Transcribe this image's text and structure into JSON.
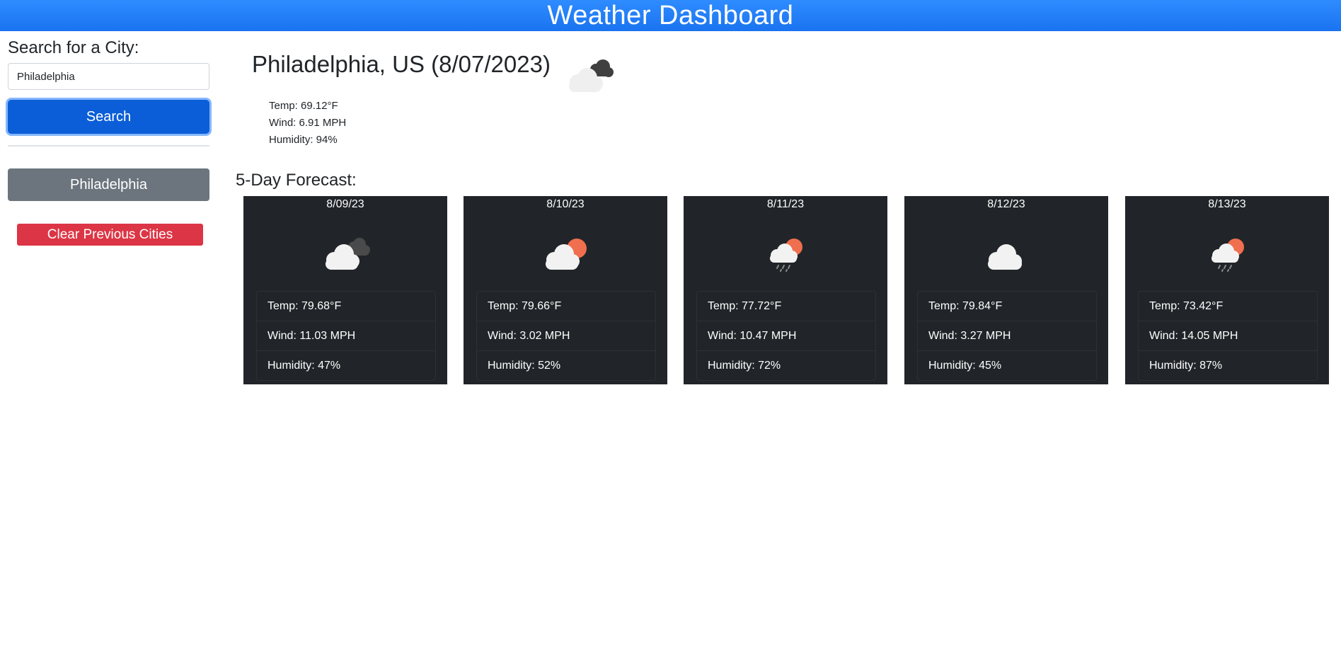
{
  "header": {
    "title": "Weather Dashboard"
  },
  "sidebar": {
    "search_heading": "Search for a City:",
    "search_value": "Philadelphia",
    "search_button": "Search",
    "history": [
      "Philadelphia"
    ],
    "clear_button": "Clear Previous Cities"
  },
  "current": {
    "title": "Philadelphia, US (8/07/2023)",
    "icon": "cloudy-icon",
    "temp": "Temp: 69.12°F",
    "wind": "Wind: 6.91 MPH",
    "humidity": "Humidity: 94%"
  },
  "forecast": {
    "title": "5-Day Forecast:",
    "days": [
      {
        "date": "8/09/23",
        "icon": "broken-clouds-icon",
        "temp": "Temp: 79.68°F",
        "wind": "Wind: 11.03 MPH",
        "humidity": "Humidity: 47%"
      },
      {
        "date": "8/10/23",
        "icon": "partly-cloudy-sun-icon",
        "temp": "Temp: 79.66°F",
        "wind": "Wind: 3.02 MPH",
        "humidity": "Humidity: 52%"
      },
      {
        "date": "8/11/23",
        "icon": "rain-sun-icon",
        "temp": "Temp: 77.72°F",
        "wind": "Wind: 10.47 MPH",
        "humidity": "Humidity: 72%"
      },
      {
        "date": "8/12/23",
        "icon": "cloud-icon",
        "temp": "Temp: 79.84°F",
        "wind": "Wind: 3.27 MPH",
        "humidity": "Humidity: 45%"
      },
      {
        "date": "8/13/23",
        "icon": "rain-sun-icon",
        "temp": "Temp: 73.42°F",
        "wind": "Wind: 14.05 MPH",
        "humidity": "Humidity: 87%"
      }
    ]
  },
  "colors": {
    "header_blue": "#1a73f0",
    "primary": "#0b5ed7",
    "secondary": "#6c757d",
    "danger": "#dc3545",
    "card_dark": "#212529",
    "sun": "#ef6f4f"
  }
}
